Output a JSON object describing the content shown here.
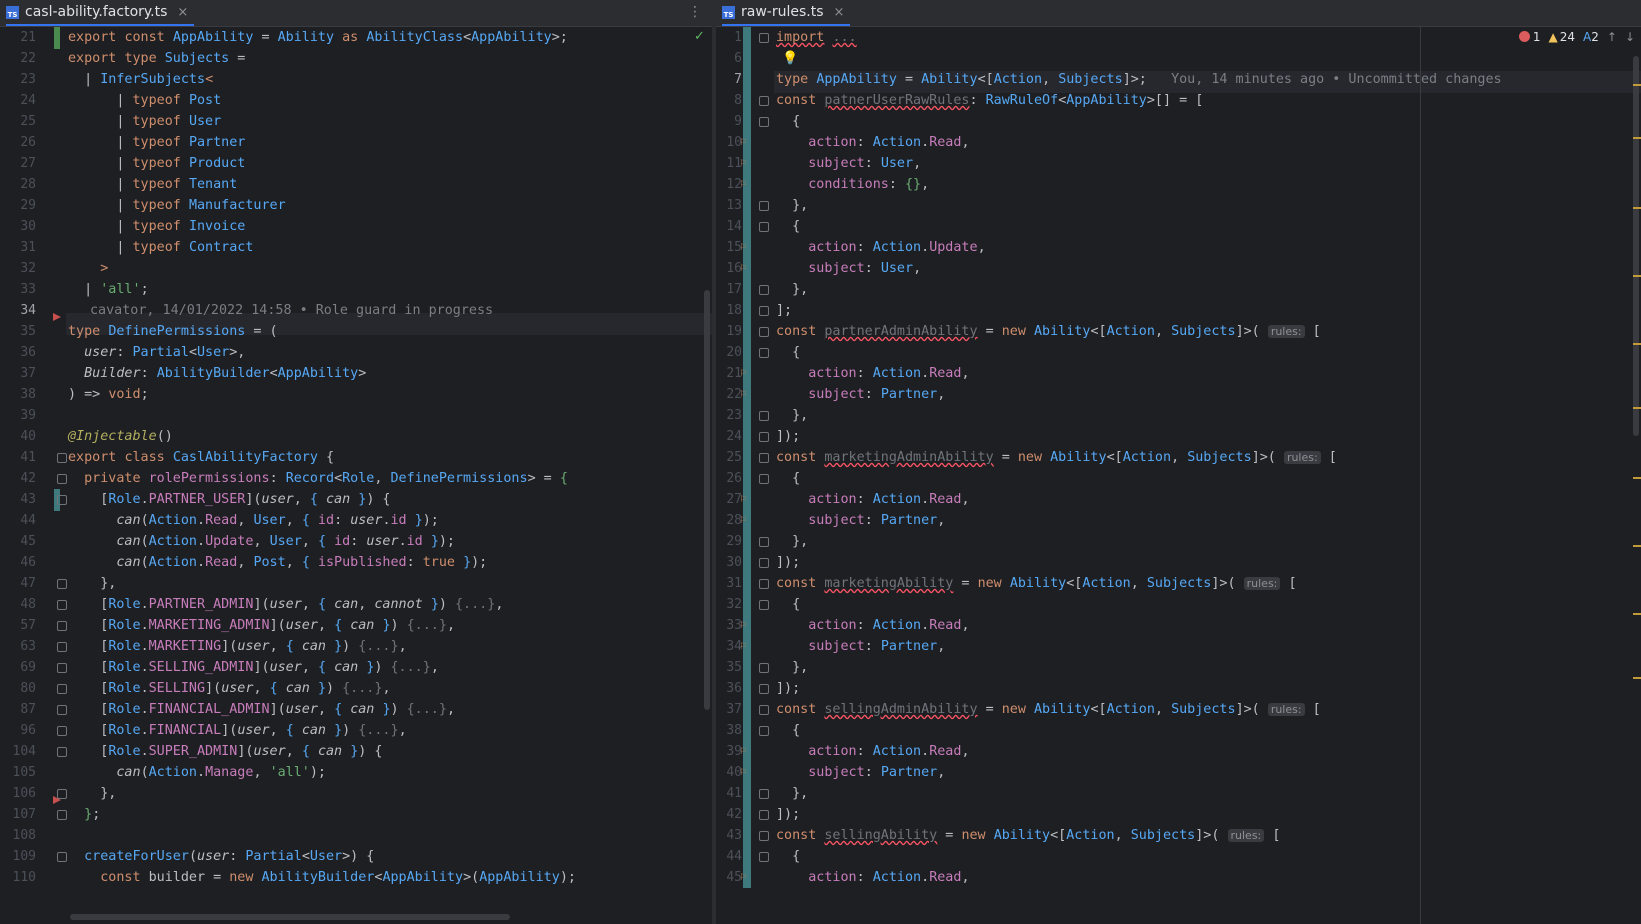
{
  "left": {
    "tab": {
      "label": "casl-ability.factory.ts",
      "badge": "TS",
      "close": "×"
    },
    "blame_line": "cavator, 14/01/2022 14:58 • Role guard in progress",
    "lines": [
      {
        "n": "21"
      },
      {
        "n": "22"
      },
      {
        "n": "23"
      },
      {
        "n": "24"
      },
      {
        "n": "25"
      },
      {
        "n": "26"
      },
      {
        "n": "27"
      },
      {
        "n": "28"
      },
      {
        "n": "29"
      },
      {
        "n": "30"
      },
      {
        "n": "31"
      },
      {
        "n": "32"
      },
      {
        "n": "33"
      },
      {
        "n": "34"
      },
      {
        "n": "35"
      },
      {
        "n": "36"
      },
      {
        "n": "37"
      },
      {
        "n": "38"
      },
      {
        "n": "39"
      },
      {
        "n": "40"
      },
      {
        "n": "41"
      },
      {
        "n": "42"
      },
      {
        "n": "43"
      },
      {
        "n": "44"
      },
      {
        "n": "45"
      },
      {
        "n": "46"
      },
      {
        "n": "47"
      },
      {
        "n": "48"
      },
      {
        "n": "57"
      },
      {
        "n": "63"
      },
      {
        "n": "69"
      },
      {
        "n": "80"
      },
      {
        "n": "87"
      },
      {
        "n": "96"
      },
      {
        "n": "104"
      },
      {
        "n": "105"
      },
      {
        "n": "106"
      },
      {
        "n": "107"
      },
      {
        "n": "108"
      },
      {
        "n": "109"
      },
      {
        "n": "110"
      }
    ]
  },
  "right": {
    "tab": {
      "label": "raw-rules.ts",
      "badge": "TS",
      "close": "×"
    },
    "blame_inline": "You, 14 minutes ago • Uncommitted changes",
    "inspections": {
      "errors": "1",
      "warnings": "24",
      "typos": "2"
    },
    "hint_label": "rules:",
    "lines": [
      {
        "n": "1"
      },
      {
        "n": "6"
      },
      {
        "n": "7"
      },
      {
        "n": "8"
      },
      {
        "n": "9"
      },
      {
        "n": "10"
      },
      {
        "n": "11"
      },
      {
        "n": "12"
      },
      {
        "n": "13"
      },
      {
        "n": "14"
      },
      {
        "n": "15"
      },
      {
        "n": "16"
      },
      {
        "n": "17"
      },
      {
        "n": "18"
      },
      {
        "n": "19"
      },
      {
        "n": "20"
      },
      {
        "n": "21"
      },
      {
        "n": "22"
      },
      {
        "n": "23"
      },
      {
        "n": "24"
      },
      {
        "n": "25"
      },
      {
        "n": "26"
      },
      {
        "n": "27"
      },
      {
        "n": "28"
      },
      {
        "n": "29"
      },
      {
        "n": "30"
      },
      {
        "n": "31"
      },
      {
        "n": "32"
      },
      {
        "n": "33"
      },
      {
        "n": "34"
      },
      {
        "n": "35"
      },
      {
        "n": "36"
      },
      {
        "n": "37"
      },
      {
        "n": "38"
      },
      {
        "n": "39"
      },
      {
        "n": "40"
      },
      {
        "n": "41"
      },
      {
        "n": "42"
      },
      {
        "n": "43"
      },
      {
        "n": "44"
      },
      {
        "n": "45"
      }
    ]
  },
  "code": {
    "export": "export",
    "const": "const",
    "type": "type",
    "as": "as",
    "typeof": "typeof",
    "class": "class",
    "private": "private",
    "new": "new",
    "import": "import",
    "void": "void",
    "true": "true",
    "cannot": "cannot",
    "AppAbility": "AppAbility",
    "Ability": "Ability",
    "AbilityClass": "AbilityClass",
    "Subjects": "Subjects",
    "InferSubjects": "InferSubjects",
    "Post": "Post",
    "User": "User",
    "Partner": "Partner",
    "Product": "Product",
    "Tenant": "Tenant",
    "Manufacturer": "Manufacturer",
    "Invoice": "Invoice",
    "Contract": "Contract",
    "all": "'all'",
    "DefinePermissions": "DefinePermissions",
    "user": "user",
    "Partial": "Partial",
    "Builder": "Builder",
    "AbilityBuilder": "AbilityBuilder",
    "Injectable": "@Injectable",
    "CaslAbilityFactory": "CaslAbilityFactory",
    "rolePermissions": "rolePermissions",
    "Record": "Record",
    "Role": "Role",
    "can": "can",
    "Action": "Action",
    "Read": "Read",
    "Update": "Update",
    "Manage": "Manage",
    "id": "id",
    "isPublished": "isPublished",
    "PARTNER_USER": "PARTNER_USER",
    "PARTNER_ADMIN": "PARTNER_ADMIN",
    "MARKETING_ADMIN": "MARKETING_ADMIN",
    "MARKETING": "MARKETING",
    "SELLING_ADMIN": "SELLING_ADMIN",
    "SELLING": "SELLING",
    "FINANCIAL_ADMIN": "FINANCIAL_ADMIN",
    "FINANCIAL": "FINANCIAL",
    "SUPER_ADMIN": "SUPER_ADMIN",
    "createForUser": "createForUser",
    "builder": "builder",
    "ellipsis": "...",
    "folded": "{...}",
    "RawRuleOf": "RawRuleOf",
    "patnerUserRawRules": "patnerUserRawRules",
    "partnerAdminAbility": "partnerAdminAbility",
    "marketingAdminAbility": "marketingAdminAbility",
    "marketingAbility": "marketingAbility",
    "sellingAdminAbility": "sellingAdminAbility",
    "sellingAbility": "sellingAbility",
    "action": "action",
    "subject": "subject",
    "conditions": "conditions"
  }
}
